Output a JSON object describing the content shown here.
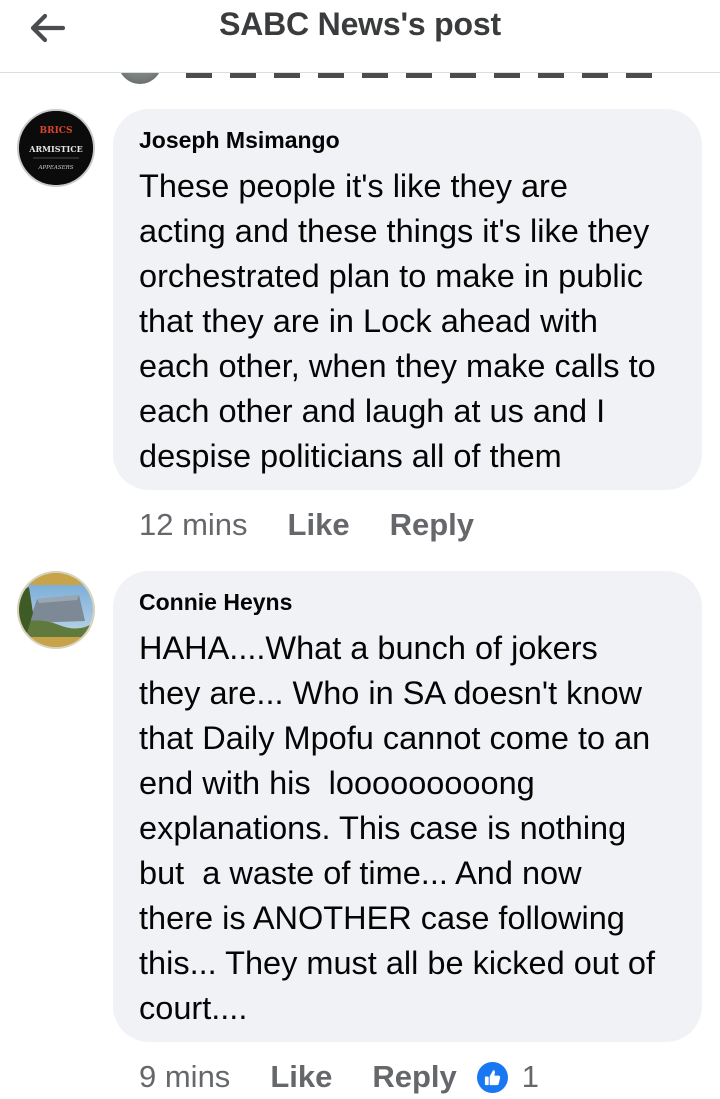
{
  "header": {
    "title": "SABC News's post",
    "back_icon": "arrow-left-icon"
  },
  "comments": [
    {
      "author": "Joseph Msimango",
      "avatar_text": [
        "BRICS",
        "ARMISTICE",
        "APPEASERS"
      ],
      "text": "These people it's like they are\nacting and these things it's like they\norchestrated plan to make in public\nthat they are in Lock ahead with\neach other, when they make calls to\neach other and laugh at us and I\ndespise politicians all of them",
      "time": "12 mins",
      "like_label": "Like",
      "reply_label": "Reply"
    },
    {
      "author": "Connie Heyns",
      "text": "HAHA....What a bunch of jokers\nthey are... Who in SA doesn't know\nthat Daily Mpofu cannot come to an\nend with his  looooooooong\nexplanations. This case is nothing\nbut  a waste of time... And now\nthere is ANOTHER case following\nthis... They must all be kicked out of\ncourt....",
      "time": "9 mins",
      "like_label": "Like",
      "reply_label": "Reply",
      "reaction_icon": "thumbs-up-icon",
      "reaction_count": "1"
    }
  ],
  "colors": {
    "bubble": "#f0f2f5",
    "meta": "#65676b",
    "like_blue": "#1877f2"
  }
}
